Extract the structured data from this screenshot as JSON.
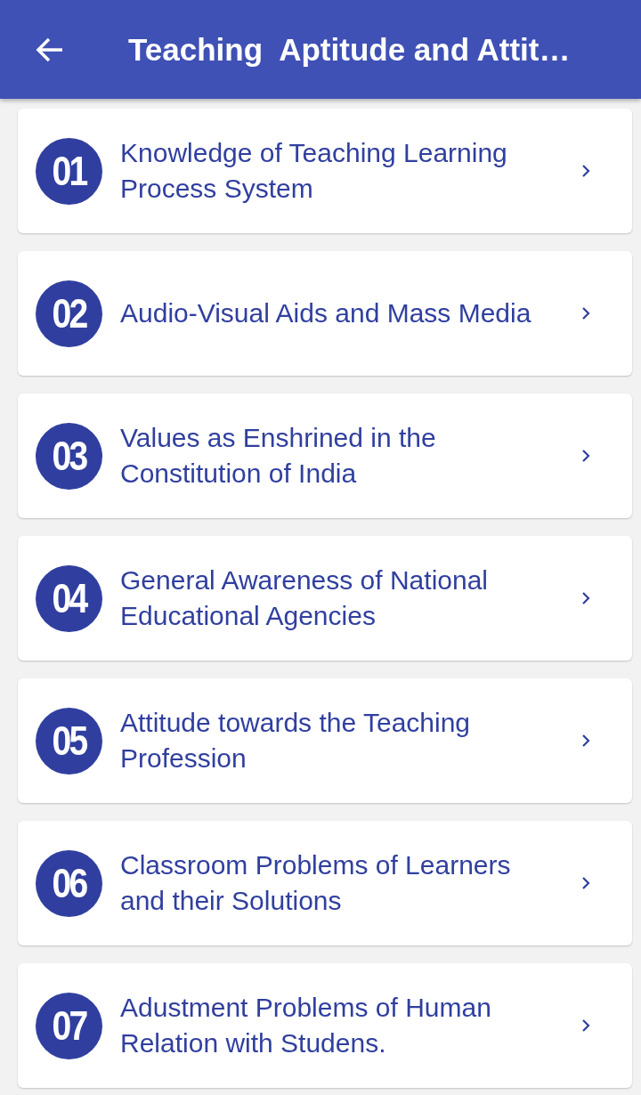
{
  "app_bar": {
    "title": "Teaching  Aptitude and Attit…"
  },
  "chapters": [
    {
      "number": "01",
      "title": "Knowledge of Teaching Learning Process System"
    },
    {
      "number": "02",
      "title": "Audio-Visual Aids and Mass Media"
    },
    {
      "number": "03",
      "title": "Values as Enshrined in the Constitution of India"
    },
    {
      "number": "04",
      "title": "General Awareness of National Educational Agencies"
    },
    {
      "number": "05",
      "title": "Attitude towards the Teaching Profession"
    },
    {
      "number": "06",
      "title": "Classroom Problems of Learners and their Solutions"
    },
    {
      "number": "07",
      "title": "Adustment Problems of Human Relation with Studens."
    }
  ]
}
